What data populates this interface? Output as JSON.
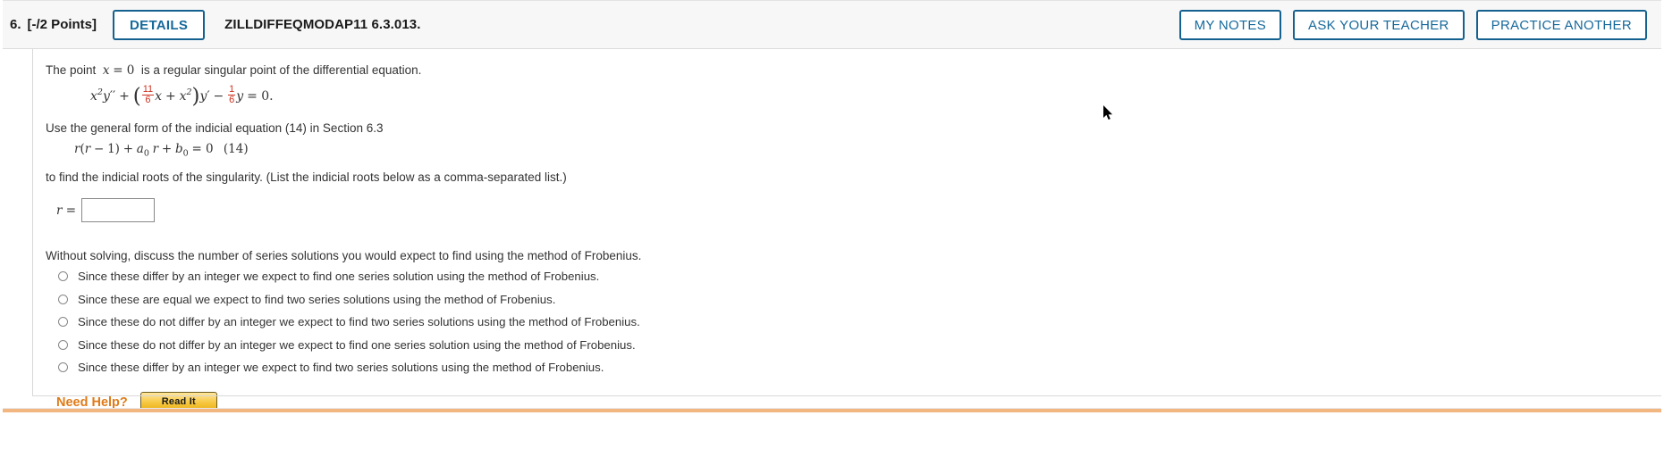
{
  "header": {
    "question_number": "6.",
    "points": "[-/2 Points]",
    "details_label": "DETAILS",
    "textbook_code": "ZILLDIFFEQMODAP11 6.3.013.",
    "my_notes_label": "MY NOTES",
    "ask_teacher_label": "ASK YOUR TEACHER",
    "practice_another_label": "PRACTICE ANOTHER",
    "accent_color": "#14618f"
  },
  "problem": {
    "intro_prefix": "The point",
    "intro_var": "x",
    "intro_eq": "= 0",
    "intro_suffix": "is a regular singular point of the differential equation.",
    "equation": {
      "lhs_x": "x",
      "lhs_x_exp": "2",
      "lhs_y": "y",
      "lhs_y_primes": "′′",
      "plus": "+",
      "frac1_num": "11",
      "frac1_den": "6",
      "inner_x": "x",
      "inner_plus": "+",
      "inner_x2": "x",
      "inner_x2_exp": "2",
      "yprime": "y",
      "yprime_mark": "′",
      "minus": "−",
      "frac2_num": "1",
      "frac2_den": "6",
      "tail_y": "y",
      "tail_eq": "= 0.",
      "fraction_color": "#cc3322"
    },
    "instruction_line": "Use the general form of the indicial equation (14) in Section 6.3",
    "indicial_equation": {
      "r1": "r",
      "open": "(",
      "r2": "r",
      "minus": "−",
      "one": "1",
      "close": ")",
      "plus1": "+",
      "a": "a",
      "a_sub": "0",
      "r3": "r",
      "plus2": "+",
      "b": "b",
      "b_sub": "0",
      "equals": "= 0",
      "tag": "(14)"
    },
    "find_roots_line": "to find the indicial roots of the singularity. (List the indicial roots below as a comma-separated list.)",
    "answer_label": "r =",
    "answer_value": "",
    "answer_placeholder": ""
  },
  "discussion": {
    "prompt": "Without solving, discuss the number of series solutions you would expect to find using the method of Frobenius.",
    "options": [
      {
        "label": "Since these differ by an integer we expect to find one series solution using the method of Frobenius.",
        "selected": false
      },
      {
        "label": "Since these are equal we expect to find two series solutions using the method of Frobenius.",
        "selected": false
      },
      {
        "label": "Since these do not differ by an integer we expect to find two series solutions using the method of Frobenius.",
        "selected": false
      },
      {
        "label": "Since these do not differ by an integer we expect to find one series solution using the method of Frobenius.",
        "selected": false
      },
      {
        "label": "Since these differ by an integer we expect to find two series solutions using the method of Frobenius.",
        "selected": false
      }
    ]
  },
  "help": {
    "label": "Need Help?",
    "read_it_label": "Read It",
    "label_color": "#e07b18"
  }
}
